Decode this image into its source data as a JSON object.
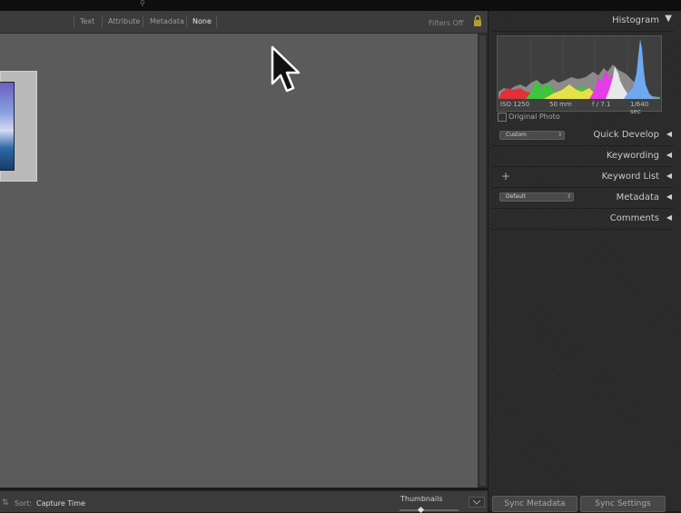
{
  "filter_bar": {
    "items": [
      {
        "label": "Text",
        "active": false
      },
      {
        "label": "Attribute",
        "active": false
      },
      {
        "label": "Metadata",
        "active": false
      },
      {
        "label": "None",
        "active": true
      }
    ],
    "filters_off": "Filters Off"
  },
  "toolbar": {
    "sort_label": "Sort:",
    "sort_value": "Capture Time",
    "thumbnails_label": "Thumbnails"
  },
  "right_panel": {
    "histogram": {
      "title": "Histogram",
      "iso": "ISO 1250",
      "focal": "50 mm",
      "aperture": "f / 7.1",
      "shutter": "1/640 sec",
      "original_photo": "Original Photo"
    },
    "quick_develop": {
      "title": "Quick Develop",
      "preset": "Custom"
    },
    "keywording": {
      "title": "Keywording"
    },
    "keyword_list": {
      "title": "Keyword List",
      "plus": "+"
    },
    "metadata": {
      "title": "Metadata",
      "preset": "Default"
    },
    "comments": {
      "title": "Comments"
    },
    "sync_metadata": "Sync Metadata",
    "sync_settings": "Sync Settings"
  },
  "colors": {
    "grid_bg": "#5b5b5b",
    "panel_bg": "#2b2b2b",
    "filter_bar_bg": "#3c3c3c"
  }
}
